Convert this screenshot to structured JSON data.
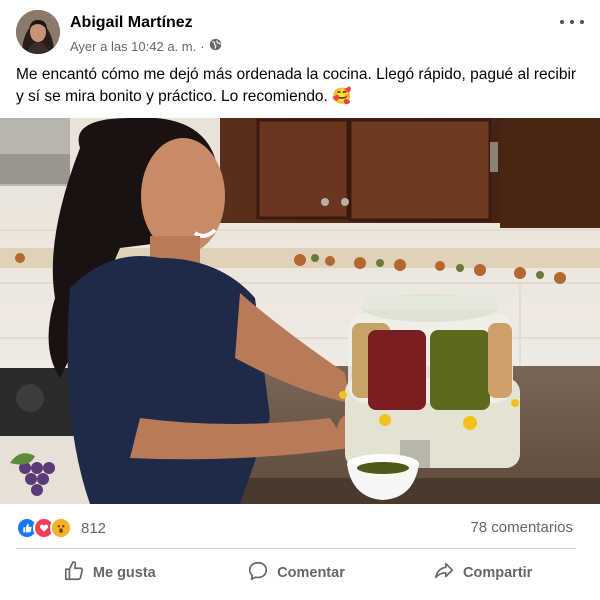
{
  "post": {
    "author": "Abigail Martínez",
    "timestamp": "Ayer a las 10:42 a. m.",
    "separator": "·",
    "privacy_icon": "globe-icon",
    "text": "Me encantó cómo me dejó más ordenada la cocina. Llegó rápido, pagué al recibir y sí se mira bonito y práctico. Lo recomiendo. 🥰"
  },
  "reactions": {
    "icons": [
      "like-icon",
      "love-icon",
      "wow-icon"
    ],
    "count": "812",
    "comments": "78 comentarios"
  },
  "actions": {
    "like": "Me gusta",
    "comment": "Comentar",
    "share": "Compartir"
  },
  "colors": {
    "like_blue": "#1877f2",
    "love_red": "#f33e58",
    "wow_yellow": "#f7b125",
    "secondary_text": "#65676b"
  }
}
